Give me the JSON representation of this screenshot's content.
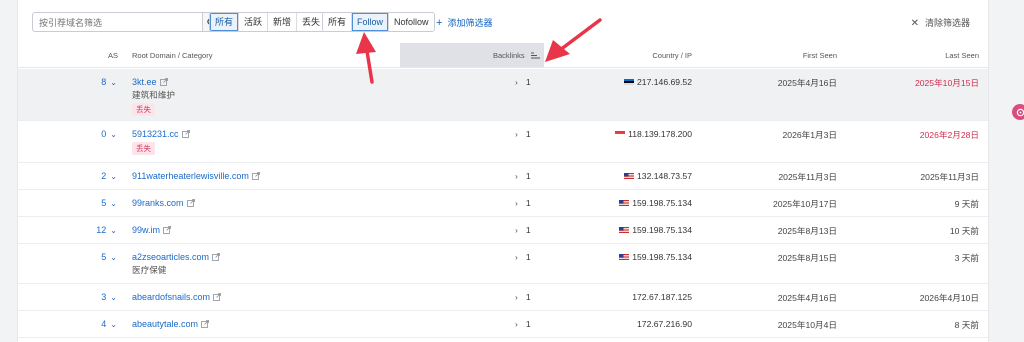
{
  "toolbar": {
    "search_placeholder": "按引荐域名筛选",
    "status_segments": [
      "所有",
      "活跃",
      "新增",
      "丢失"
    ],
    "status_selected": "所有",
    "link_segments": [
      "所有",
      "Follow",
      "Nofollow"
    ],
    "link_selected": "Follow",
    "add_filter": "添加筛选器",
    "clear_filter": "清除筛选器"
  },
  "table": {
    "headers": {
      "as": "AS",
      "domain": "Root Domain / Category",
      "backlinks": "Backlinks",
      "country_ip": "Country / IP",
      "first_seen": "First Seen",
      "last_seen": "Last Seen"
    },
    "rows": [
      {
        "as": "8",
        "domain": "3kt.ee",
        "category": "建筑和维护",
        "tag": "丢失",
        "backlinks": "1",
        "flag": "ee",
        "ip": "217.146.69.52",
        "first_seen": "2025年4月16日",
        "last_seen": "2025年10月15日",
        "last_red": true
      },
      {
        "as": "0",
        "domain": "5913231.cc",
        "category": "",
        "tag": "丢失",
        "backlinks": "1",
        "flag": "sg",
        "ip": "118.139.178.200",
        "first_seen": "2026年1月3日",
        "last_seen": "2026年2月28日",
        "last_red": true
      },
      {
        "as": "2",
        "domain": "911waterheaterlewisville.com",
        "category": "",
        "tag": "",
        "backlinks": "1",
        "flag": "us",
        "ip": "132.148.73.57",
        "first_seen": "2025年11月3日",
        "last_seen": "2025年11月3日",
        "last_red": false
      },
      {
        "as": "5",
        "domain": "99ranks.com",
        "category": "",
        "tag": "",
        "backlinks": "1",
        "flag": "us",
        "ip": "159.198.75.134",
        "first_seen": "2025年10月17日",
        "last_seen": "9 天前",
        "last_red": false
      },
      {
        "as": "12",
        "domain": "99w.im",
        "category": "",
        "tag": "",
        "backlinks": "1",
        "flag": "us",
        "ip": "159.198.75.134",
        "first_seen": "2025年8月13日",
        "last_seen": "10 天前",
        "last_red": false
      },
      {
        "as": "5",
        "domain": "a2zseoarticles.com",
        "category": "医疗保健",
        "tag": "",
        "backlinks": "1",
        "flag": "us",
        "ip": "159.198.75.134",
        "first_seen": "2025年8月15日",
        "last_seen": "3 天前",
        "last_red": false
      },
      {
        "as": "3",
        "domain": "abeardofsnails.com",
        "category": "",
        "tag": "",
        "backlinks": "1",
        "flag": "",
        "ip": "172.67.187.125",
        "first_seen": "2025年4月16日",
        "last_seen": "2026年4月10日",
        "last_red": false
      },
      {
        "as": "4",
        "domain": "abeautytale.com",
        "category": "",
        "tag": "",
        "backlinks": "1",
        "flag": "",
        "ip": "172.67.216.90",
        "first_seen": "2025年10月4日",
        "last_seen": "8 天前",
        "last_red": false
      }
    ]
  },
  "colors": {
    "accent": "#1b6ac9",
    "lost_red": "#d0304e",
    "annotation_red": "#e8354a"
  }
}
